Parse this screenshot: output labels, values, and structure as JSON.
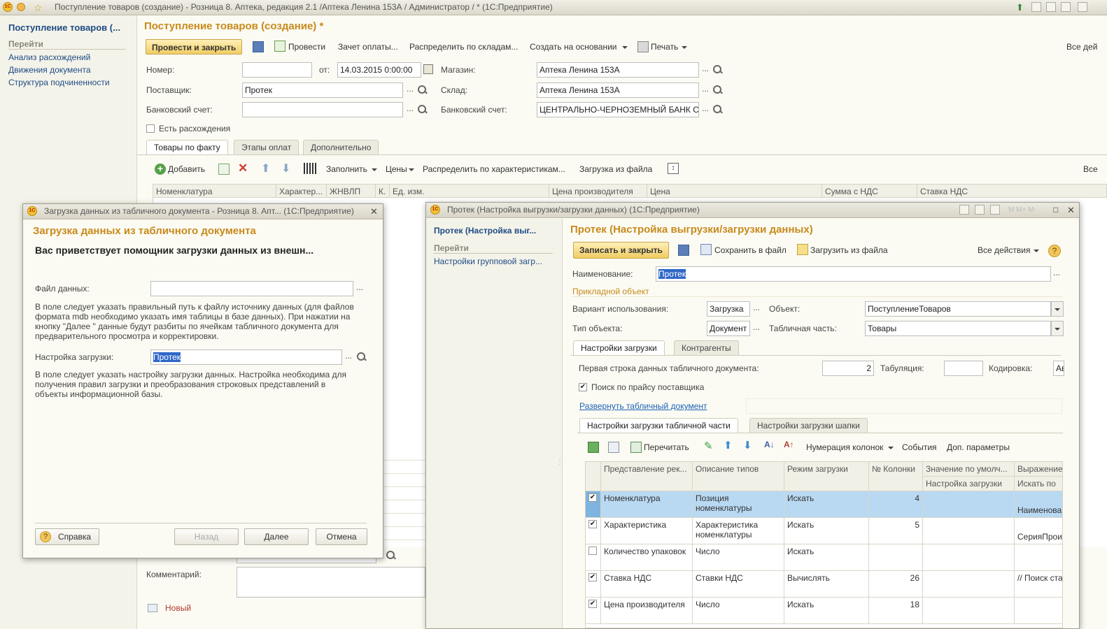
{
  "titlebar": {
    "text": "Поступление товаров (создание) - Розница 8. Аптека, редакция 2.1 /Аптека Ленина 153А / Администратор / * (1С:Предприятие)"
  },
  "left_panel": {
    "title": "Поступление товаров (...",
    "section": "Перейти",
    "links": [
      "Анализ расхождений",
      "Движения документа",
      "Структура подчиненности"
    ]
  },
  "main": {
    "title": "Поступление товаров (создание) *",
    "toolbar": {
      "post_close": "Провести и закрыть",
      "post": "Провести",
      "offset": "Зачет оплаты...",
      "distribute": "Распределить по складам...",
      "create_based": "Создать на основании",
      "print": "Печать",
      "all_actions": "Все дей"
    },
    "fields": {
      "number_label": "Номер:",
      "number_value": "",
      "from_label": "от:",
      "date_value": "14.03.2015  0:00:00",
      "store_label": "Магазин:",
      "store_value": "Аптека Ленина 153А",
      "supplier_label": "Поставщик:",
      "supplier_value": "Протек",
      "warehouse_label": "Склад:",
      "warehouse_value": "Аптека Ленина 153А",
      "bank_label": "Банковский счет:",
      "bank_value": "",
      "bank2_label": "Банковский счет:",
      "bank2_value": "ЦЕНТРАЛЬНО-ЧЕРНОЗЕМНЫЙ БАНК С",
      "discrepancy_label": "Есть расхождения",
      "discrepancy_checked": false
    },
    "tabs": [
      "Товары по факту",
      "Этапы оплат",
      "Дополнительно"
    ],
    "goods_toolbar": {
      "add": "Добавить",
      "fill": "Заполнить",
      "prices": "Цены",
      "distribute_chars": "Распределить по характеристикам...",
      "load_file": "Загрузка из файла",
      "all": "Все"
    },
    "grid_headers": [
      "Номенклатура",
      "Характер...",
      "ЖНВЛП",
      "К.",
      "Ед. изм.",
      "Цена производителя",
      "Цена",
      "Сумма с НДС",
      "Ставка НДС"
    ],
    "comment_label": "Комментарий:",
    "comment_value": "",
    "status": "Новый"
  },
  "dialog1": {
    "title": "Загрузка данных из табличного документа - Розница 8. Апт... (1С:Предприятие)",
    "heading": "Загрузка данных из табличного документа",
    "welcome": "Вас приветствует помощник загрузки данных из внешн...",
    "file_label": "Файл данных:",
    "file_value": "",
    "hint1": [
      "В поле следует указать правильный путь к файлу источнику данных (для файлов",
      "формата mdb необходимо указать имя таблицы в базе данных). При нажатии на",
      "кнопку \"Далее \" данные будут разбиты по ячейкам табличного документа для",
      "предварительного просмотра и корректировки."
    ],
    "setting_label": "Настройка загрузки:",
    "setting_value": "Протек",
    "hint2": [
      "В поле следует указать настройку загрузки данных. Настройка необходима для",
      "получения правил загрузки и преобразования строковых представлений в",
      "объекты информационной базы."
    ],
    "buttons": {
      "help": "Справка",
      "back": "Назад",
      "next": "Далее",
      "cancel": "Отмена"
    }
  },
  "dialog2": {
    "title": "Протек (Настройка выгрузки/загрузки данных) (1С:Предприятие)",
    "nav_title": "Протек (Настройка выг...",
    "nav_section": "Перейти",
    "nav_link": "Настройки групповой загр...",
    "heading": "Протек (Настройка выгрузки/загрузки данных)",
    "toolbar": {
      "save_close": "Записать и закрыть",
      "save_file": "Сохранить в файл",
      "load_file": "Загрузить из файла",
      "all_actions": "Все действия",
      "help_glyph": "?"
    },
    "name_label": "Наименование:",
    "name_value": "Протек",
    "app_object": "Прикладной объект",
    "usage_label": "Вариант использования:",
    "usage_value": "Загрузка",
    "object_label": "Объект:",
    "object_value": "ПоступлениеТоваров",
    "objtype_label": "Тип объекта:",
    "objtype_value": "Документ",
    "tabpart_label": "Табличная часть:",
    "tabpart_value": "Товары",
    "tabs": [
      "Настройки загрузки",
      "Контрагенты"
    ],
    "first_row_label": "Первая строка данных табличного документа:",
    "first_row_value": "2",
    "tab_label": "Табуляция:",
    "tab_value": "",
    "encoding_label": "Кодировка:",
    "encoding_value": "Ав",
    "price_search_label": "Поиск по прайсу поставщика",
    "price_search_checked": true,
    "expand_link": "Развернуть табличный документ",
    "subtabs": [
      "Настройки загрузки табличной части",
      "Настройки загрузки шапки"
    ],
    "grid_toolbar": {
      "reread": "Перечитать",
      "numbering": "Нумерация колонок",
      "events": "События",
      "extra": "Доп. параметры"
    },
    "grid_headers": [
      "Представление рек...",
      "Описание типов",
      "Режим загрузки",
      "№ Колонки",
      "Значение по умолч...",
      "Выражение"
    ],
    "grid_subheaders": [
      "Настройка загрузки",
      "Искать по"
    ],
    "rows": [
      {
        "checked": true,
        "name": "Номенклатура",
        "type": "Позиция номенклатуры",
        "mode": "Искать",
        "col": "4",
        "default": "",
        "expr": "Наименова"
      },
      {
        "checked": true,
        "name": "Характеристика",
        "type": "Характеристика номенклатуры",
        "mode": "Искать",
        "col": "5",
        "default": "",
        "expr": "СерияПрои"
      },
      {
        "checked": false,
        "name": "Количество упаковок",
        "type": "Число",
        "mode": "Искать",
        "col": "",
        "default": "",
        "expr": ""
      },
      {
        "checked": true,
        "name": "Ставка НДС",
        "type": "Ставки НДС",
        "mode": "Вычислять",
        "col": "26",
        "default": "",
        "expr": "// Поиск ста"
      },
      {
        "checked": true,
        "name": "Цена производителя",
        "type": "Число",
        "mode": "Искать",
        "col": "18",
        "default": "",
        "expr": ""
      }
    ]
  },
  "colors": {
    "accent_title": "#c88a1c",
    "link": "#1f4b84",
    "selection": "#2f67c8",
    "row_selected": "#b9d9f3"
  }
}
